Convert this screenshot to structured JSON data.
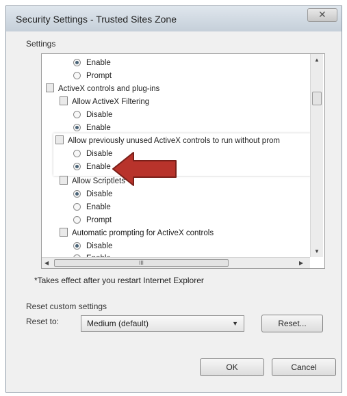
{
  "window": {
    "title": "Security Settings - Trusted Sites Zone",
    "close_glyph": "✕"
  },
  "settings": {
    "legend": "Settings",
    "rows": [
      {
        "kind": "radio",
        "label": "Enable",
        "selected": true
      },
      {
        "kind": "radio",
        "label": "Prompt",
        "selected": false
      },
      {
        "kind": "category",
        "label": "ActiveX controls and plug-ins"
      },
      {
        "kind": "setting",
        "label": "Allow ActiveX Filtering"
      },
      {
        "kind": "radio",
        "label": "Disable",
        "selected": false
      },
      {
        "kind": "radio",
        "label": "Enable",
        "selected": true
      },
      {
        "kind": "setting",
        "label": "Allow previously unused ActiveX controls to run without prom"
      },
      {
        "kind": "radio",
        "label": "Disable",
        "selected": false
      },
      {
        "kind": "radio",
        "label": "Enable",
        "selected": true
      },
      {
        "kind": "setting",
        "label": "Allow Scriptlets"
      },
      {
        "kind": "radio",
        "label": "Disable",
        "selected": true
      },
      {
        "kind": "radio",
        "label": "Enable",
        "selected": false
      },
      {
        "kind": "radio",
        "label": "Prompt",
        "selected": false
      },
      {
        "kind": "setting",
        "label": "Automatic prompting for ActiveX controls"
      },
      {
        "kind": "radio",
        "label": "Disable",
        "selected": true
      },
      {
        "kind": "radio",
        "label": "Enable",
        "selected": false
      }
    ],
    "hscroll_grip": "III"
  },
  "note": "*Takes effect after you restart Internet Explorer",
  "reset": {
    "legend": "Reset custom settings",
    "label": "Reset to:",
    "selected": "Medium (default)",
    "button": "Reset..."
  },
  "buttons": {
    "ok": "OK",
    "cancel": "Cancel"
  },
  "colors": {
    "annotation_arrow": "#b8332b"
  }
}
